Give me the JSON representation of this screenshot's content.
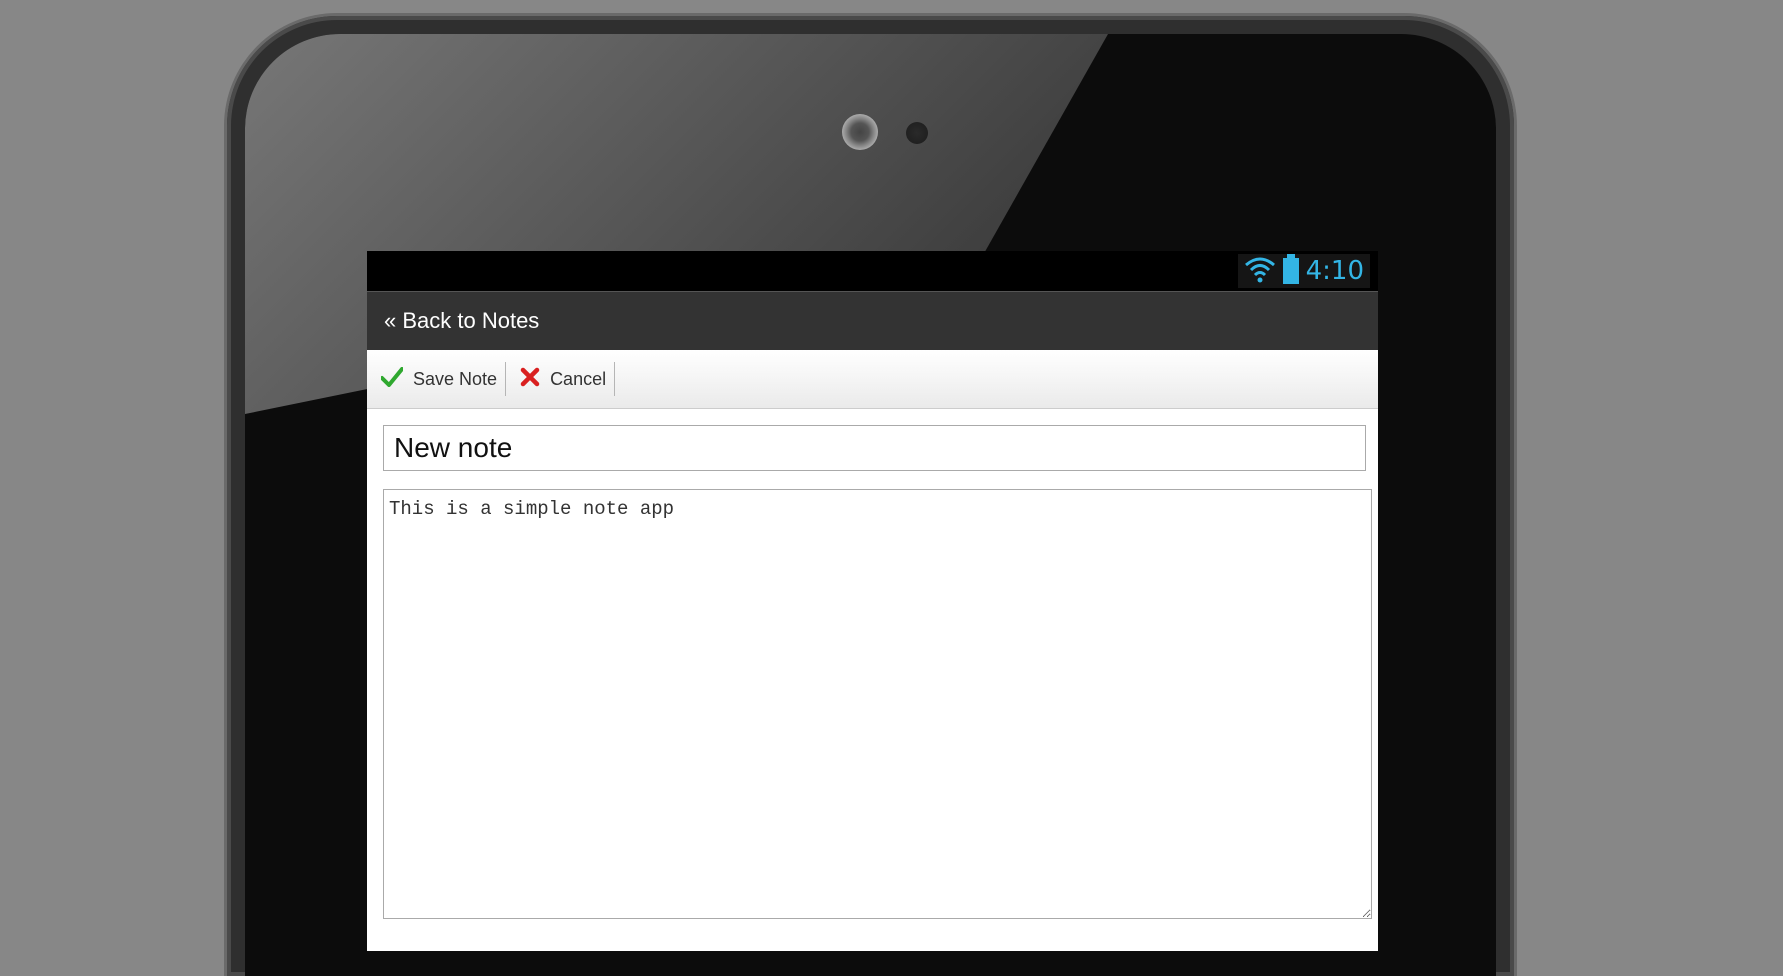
{
  "status_bar": {
    "time": "4:10",
    "wifi_icon": "wifi-icon",
    "battery_icon": "battery-icon",
    "accent_color": "#33b5e5"
  },
  "header": {
    "back_label": "« Back to Notes"
  },
  "toolbar": {
    "save_label": "Save Note",
    "cancel_label": "Cancel"
  },
  "note": {
    "title_value": "New note",
    "body_value": "This is a simple note app"
  }
}
